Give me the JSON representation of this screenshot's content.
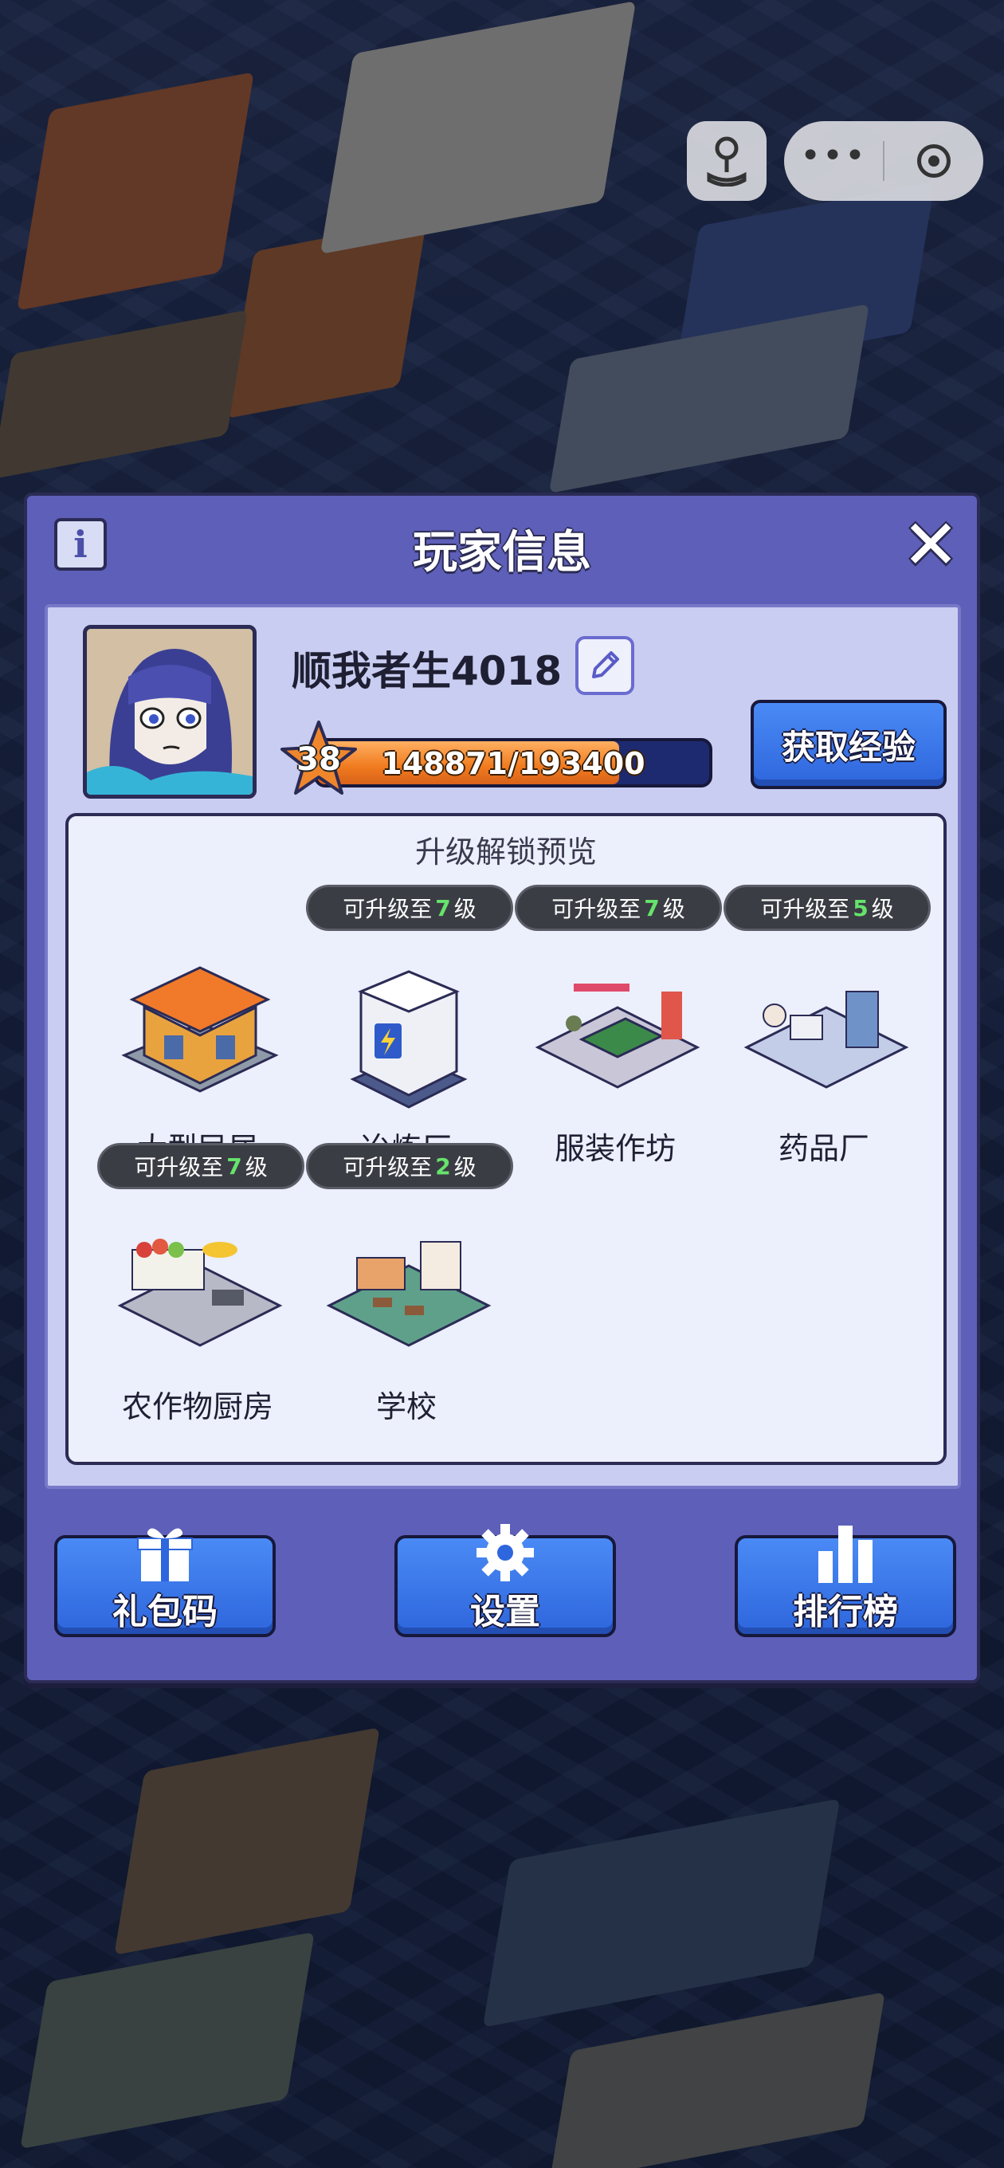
{
  "panel": {
    "title": "玩家信息",
    "info_icon": "info-icon",
    "close_icon": "close-icon"
  },
  "player": {
    "name": "顺我者生4018",
    "level": "38",
    "exp_text": "148871/193400",
    "exp_fraction": 0.77,
    "get_exp_label": "获取经验"
  },
  "preview": {
    "title": "升级解锁预览",
    "buildings": [
      {
        "name": "大型民居",
        "tag_prefix": "",
        "tag_level": "",
        "tag_suffix": ""
      },
      {
        "name": "冶炼厂",
        "tag_prefix": "可升级至",
        "tag_level": "7",
        "tag_suffix": "级"
      },
      {
        "name": "服装作坊",
        "tag_prefix": "可升级至",
        "tag_level": "7",
        "tag_suffix": "级"
      },
      {
        "name": "药品厂",
        "tag_prefix": "可升级至",
        "tag_level": "5",
        "tag_suffix": "级"
      },
      {
        "name": "农作物厨房",
        "tag_prefix": "可升级至",
        "tag_level": "7",
        "tag_suffix": "级"
      },
      {
        "name": "学校",
        "tag_prefix": "可升级至",
        "tag_level": "2",
        "tag_suffix": "级"
      }
    ]
  },
  "bottom": {
    "gift_label": "礼包码",
    "settings_label": "设置",
    "ranking_label": "排行榜"
  },
  "colors": {
    "panel": "#5d5fb8",
    "button_blue": "#3a78ec",
    "exp_orange": "#f07a1e",
    "level_green": "#66e36c"
  }
}
